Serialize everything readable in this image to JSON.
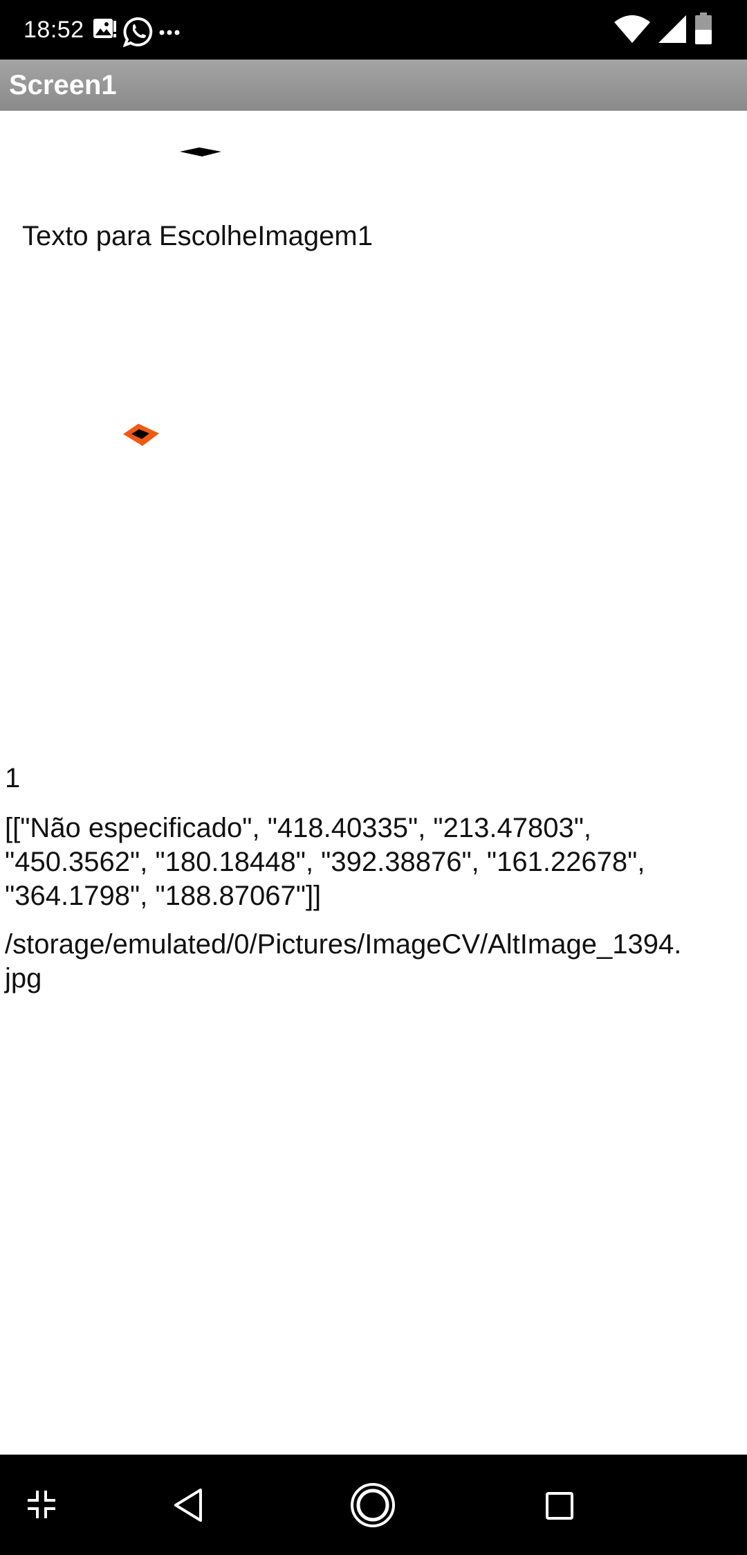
{
  "status_bar": {
    "time": "18:52",
    "icons": [
      "gallery-notification-icon",
      "whatsapp-icon",
      "more-notifications-icon",
      "wifi-icon",
      "cell-signal-icon",
      "battery-icon"
    ]
  },
  "title_bar": {
    "title": "Screen1"
  },
  "main": {
    "image_picker_label": "Texto para EscolheImagem1",
    "count_label": "1",
    "result_label": "[[\"Não especificado\", \"418.40335\", \"213.47803\", \"450.3562\", \"180.18448\", \"392.38876\", \"161.22678\", \"364.1798\", \"188.87067\"]]",
    "path_label": "/storage/emulated/0/Pictures/ImageCV/AltImage_1394.jpg"
  },
  "colors": {
    "status_bar_bg": "#000000",
    "title_bar_bg": "#999999",
    "marker_orange": "#f05a14"
  },
  "nav_bar": {
    "icons": [
      "collapse-icon",
      "back-icon",
      "home-icon",
      "recents-icon"
    ]
  }
}
